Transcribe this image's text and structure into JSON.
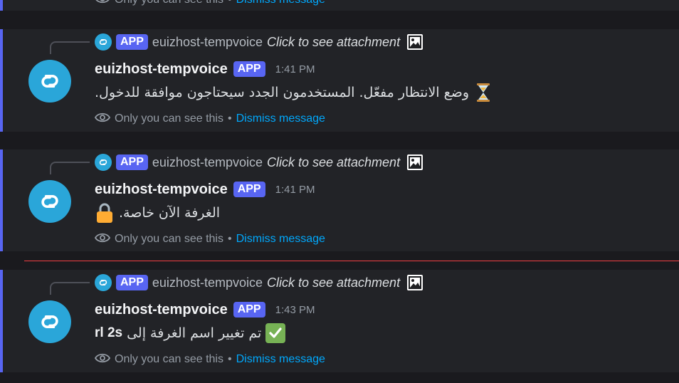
{
  "top_partial": {
    "ephemeral_text": "Only you can see this",
    "dismiss_label": "Dismiss message"
  },
  "colors": {
    "accent": "#5865f2",
    "avatar_bg": "#2aa6d9",
    "link": "#00a8fc",
    "new_divider": "#f23f43"
  },
  "messages": [
    {
      "reply_tag": "APP",
      "reply_name": "euizhost-tempvoice",
      "reply_text": "Click to see attachment",
      "username": "euizhost-tempvoice",
      "app_tag": "APP",
      "time": "1:41 PM",
      "emoji_icon": "hourglass-icon",
      "text": "وضع الانتظار مفعّل. المستخدمون الجدد سيحتاجون موافقة للدخول.",
      "ephemeral_text": "Only you can see this",
      "dismiss_label": "Dismiss message"
    },
    {
      "reply_tag": "APP",
      "reply_name": "euizhost-tempvoice",
      "reply_text": "Click to see attachment",
      "username": "euizhost-tempvoice",
      "app_tag": "APP",
      "time": "1:41 PM",
      "emoji_icon": "lock-icon",
      "text": "الغرفة الآن خاصة.",
      "ephemeral_text": "Only you can see this",
      "dismiss_label": "Dismiss message"
    },
    {
      "reply_tag": "APP",
      "reply_name": "euizhost-tempvoice",
      "reply_text": "Click to see attachment",
      "username": "euizhost-tempvoice",
      "app_tag": "APP",
      "time": "1:43 PM",
      "emoji_icon": "check-mark-icon",
      "text": "تم تغيير اسم الغرفة إلى",
      "text_bold": "rl 2s",
      "ephemeral_text": "Only you can see this",
      "dismiss_label": "Dismiss message"
    }
  ]
}
